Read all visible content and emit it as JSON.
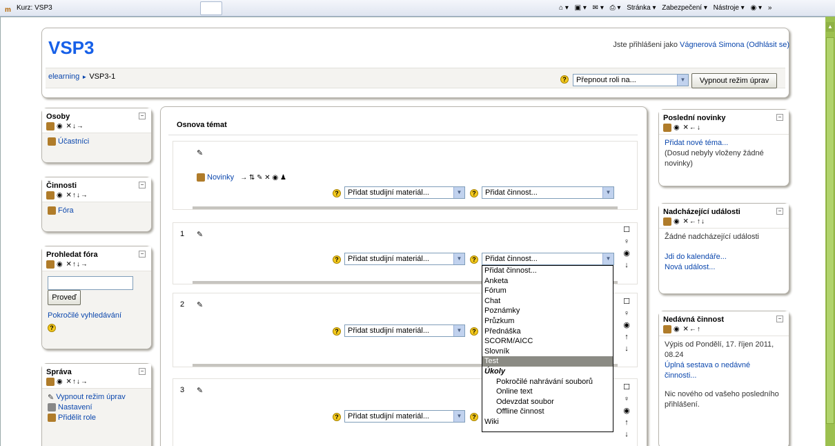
{
  "browser": {
    "tab_title": "Kurz: VSP3",
    "logo": "m",
    "commands": [
      "Stránka ▾",
      "Zabezpečení ▾",
      "Nástroje ▾"
    ],
    "overflow": "»"
  },
  "header": {
    "site_title": "VSP3",
    "login_prefix": "Jste přihlášeni jako ",
    "user_name": "Vágnerová Simona",
    "logout": "(Odhlásit se)",
    "breadcrumb_home": "elearning",
    "breadcrumb_sep": "►",
    "breadcrumb_course": "VSP3-1",
    "role_select": "Přepnout roli na...",
    "edit_button": "Vypnout režim úprav"
  },
  "left": {
    "osoby": {
      "title": "Osoby",
      "controls": "✕↓→",
      "participants": "Účastníci"
    },
    "cinnosti": {
      "title": "Činnosti",
      "controls": "✕↑↓→",
      "fora": "Fóra"
    },
    "prohledat": {
      "title": "Prohledat fóra",
      "controls": "✕↑↓→",
      "button": "Proveď",
      "advanced": "Pokročilé vyhledávání"
    },
    "sprava": {
      "title": "Správa",
      "controls": "✕↑↓→",
      "items": [
        "Vypnout režim úprav",
        "Nastavení",
        "Přidělit role"
      ]
    }
  },
  "main": {
    "title": "Osnova témat",
    "news_link": "Novinky",
    "news_controls": "→ ⇅ ✎ ✕ ◉ ♟",
    "add_resource": "Přidat studijní materiál...",
    "add_activity": "Přidat činnost...",
    "section_numbers": [
      "1",
      "2",
      "3"
    ]
  },
  "dropdown": {
    "items": [
      "Přidat činnost...",
      "Anketa",
      "Fórum",
      "Chat",
      "Poznámky",
      "Průzkum",
      "Přednáška",
      "SCORM/AICC",
      "Slovník",
      "Test"
    ],
    "group": "Úkoly",
    "sub_items": [
      "Pokročilé nahrávání souborů",
      "Online text",
      "Odevzdat soubor",
      "Offline činnost"
    ],
    "last": "Wiki",
    "highlighted": "Test"
  },
  "right": {
    "novinky": {
      "title": "Poslední novinky",
      "controls": "✕←↓",
      "add": "Přidat nové téma...",
      "none": "(Dosud nebyly vloženy žádné novinky)"
    },
    "udalosti": {
      "title": "Nadcházející události",
      "controls": "✕←↑↓",
      "none": "Žádné nadcházející události",
      "calendar": "Jdi do kalendáře...",
      "new_event": "Nová událost..."
    },
    "cinnost": {
      "title": "Nedávná činnost",
      "controls": "✕←↑",
      "since": "Výpis od Pondělí, 17. říjen 2011, 08.24",
      "report": "Úplná sestava o nedávné činnosti...",
      "nothing": "Nic nového od vašeho posledního přihlášení."
    }
  }
}
